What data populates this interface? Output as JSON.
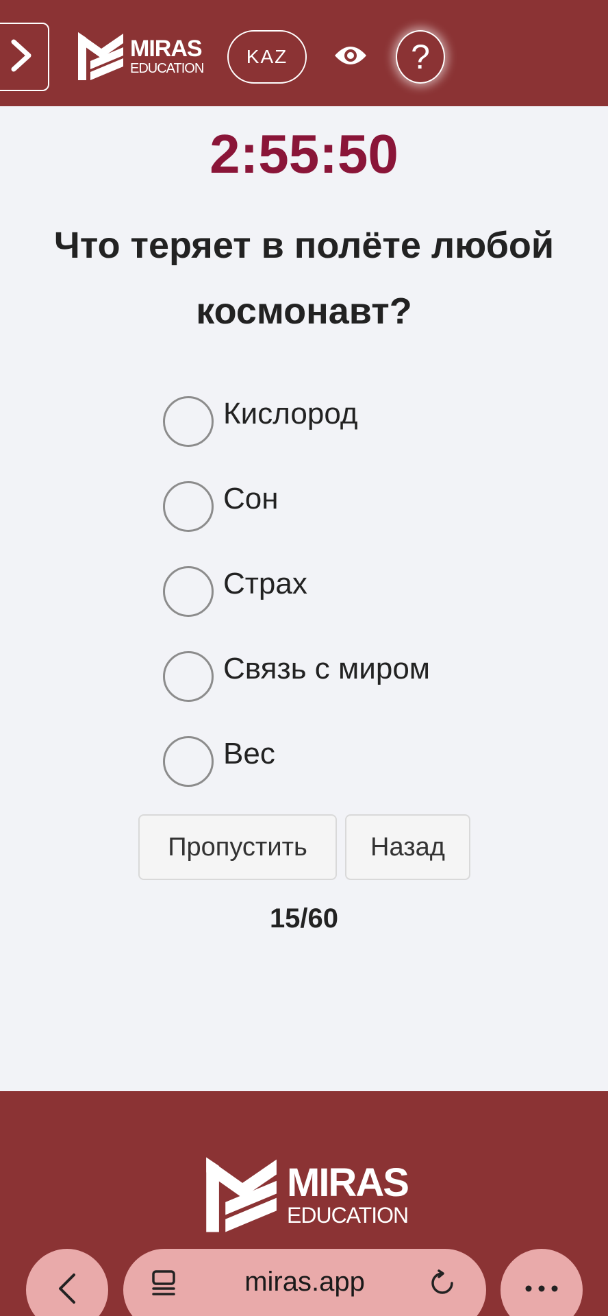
{
  "header": {
    "logo": {
      "brand": "MIRAS",
      "sub": "EDUCATION"
    },
    "language": "KAZ",
    "help_symbol": "?"
  },
  "quiz": {
    "timer": "2:55:50",
    "question": "Что теряет в полёте любой космонавт?",
    "options": [
      "Кислород",
      "Сон",
      "Страх",
      "Связь с миром",
      "Вес"
    ],
    "skip_label": "Пропустить",
    "back_label": "Назад",
    "progress": "15/60"
  },
  "footer": {
    "logo": {
      "brand": "MIRAS",
      "sub": "EDUCATION"
    }
  },
  "browser": {
    "url": "miras.app"
  },
  "colors": {
    "header_bg": "#8b3334",
    "timer": "#8a1538",
    "page_bg": "#f2f3f7",
    "browser_controls": "#e9aaaa"
  }
}
